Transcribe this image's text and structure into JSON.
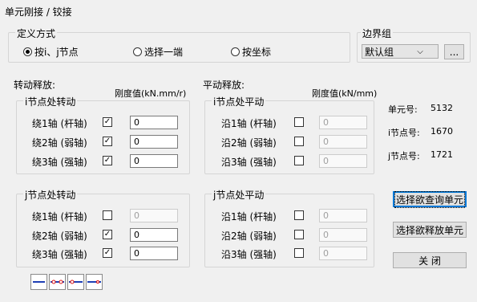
{
  "window": {
    "title": "单元刚接 / 铰接"
  },
  "define_mode": {
    "legend": "定义方式",
    "options": [
      {
        "label": "按i、j节点",
        "selected": true
      },
      {
        "label": "选择一端",
        "selected": false
      },
      {
        "label": "按坐标",
        "selected": false
      }
    ]
  },
  "boundary_group": {
    "legend": "边界组",
    "selected": "默认组",
    "more_label": "..."
  },
  "rotation_release": {
    "title": "转动释放:",
    "stiffness_header": "刚度值(kN.mm/r)",
    "i_node": {
      "legend": "i节点处转动",
      "rows": [
        {
          "label": "绕1轴 (杆轴)",
          "checked": true,
          "value": "0",
          "enabled": true
        },
        {
          "label": "绕2轴 (弱轴)",
          "checked": true,
          "value": "0",
          "enabled": true
        },
        {
          "label": "绕3轴 (强轴)",
          "checked": true,
          "value": "0",
          "enabled": true
        }
      ]
    },
    "j_node": {
      "legend": "j节点处转动",
      "rows": [
        {
          "label": "绕1轴 (杆轴)",
          "checked": false,
          "value": "0",
          "enabled": false
        },
        {
          "label": "绕2轴 (弱轴)",
          "checked": true,
          "value": "0",
          "enabled": true
        },
        {
          "label": "绕3轴 (强轴)",
          "checked": true,
          "value": "0",
          "enabled": true
        }
      ]
    }
  },
  "translation_release": {
    "title": "平动释放:",
    "stiffness_header": "刚度值(kN/mm)",
    "i_node": {
      "legend": "i节点处平动",
      "rows": [
        {
          "label": "沿1轴 (杆轴)",
          "checked": false,
          "value": "0",
          "enabled": false
        },
        {
          "label": "沿2轴 (弱轴)",
          "checked": false,
          "value": "0",
          "enabled": false
        },
        {
          "label": "沿3轴 (强轴)",
          "checked": false,
          "value": "0",
          "enabled": false
        }
      ]
    },
    "j_node": {
      "legend": "j节点处平动",
      "rows": [
        {
          "label": "沿1轴 (杆轴)",
          "checked": false,
          "value": "0",
          "enabled": false
        },
        {
          "label": "沿2轴 (弱轴)",
          "checked": false,
          "value": "0",
          "enabled": false
        },
        {
          "label": "沿3轴 (强轴)",
          "checked": false,
          "value": "0",
          "enabled": false
        }
      ]
    }
  },
  "element_info": {
    "element_label": "单元号:",
    "element_value": "5132",
    "i_node_label": "i节点号:",
    "i_node_value": "1670",
    "j_node_label": "j节点号:",
    "j_node_value": "1721"
  },
  "buttons": {
    "query": "选择欲查询单元",
    "release": "选择欲释放单元",
    "close": "关   闭"
  },
  "toolbar_icons": [
    "rigid-beam-icon",
    "hinge-both-ends-icon",
    "hinge-i-end-icon",
    "hinge-j-end-icon"
  ],
  "colors": {
    "icon_line": "#1f3fb5",
    "icon_hinge": "#d11"
  }
}
